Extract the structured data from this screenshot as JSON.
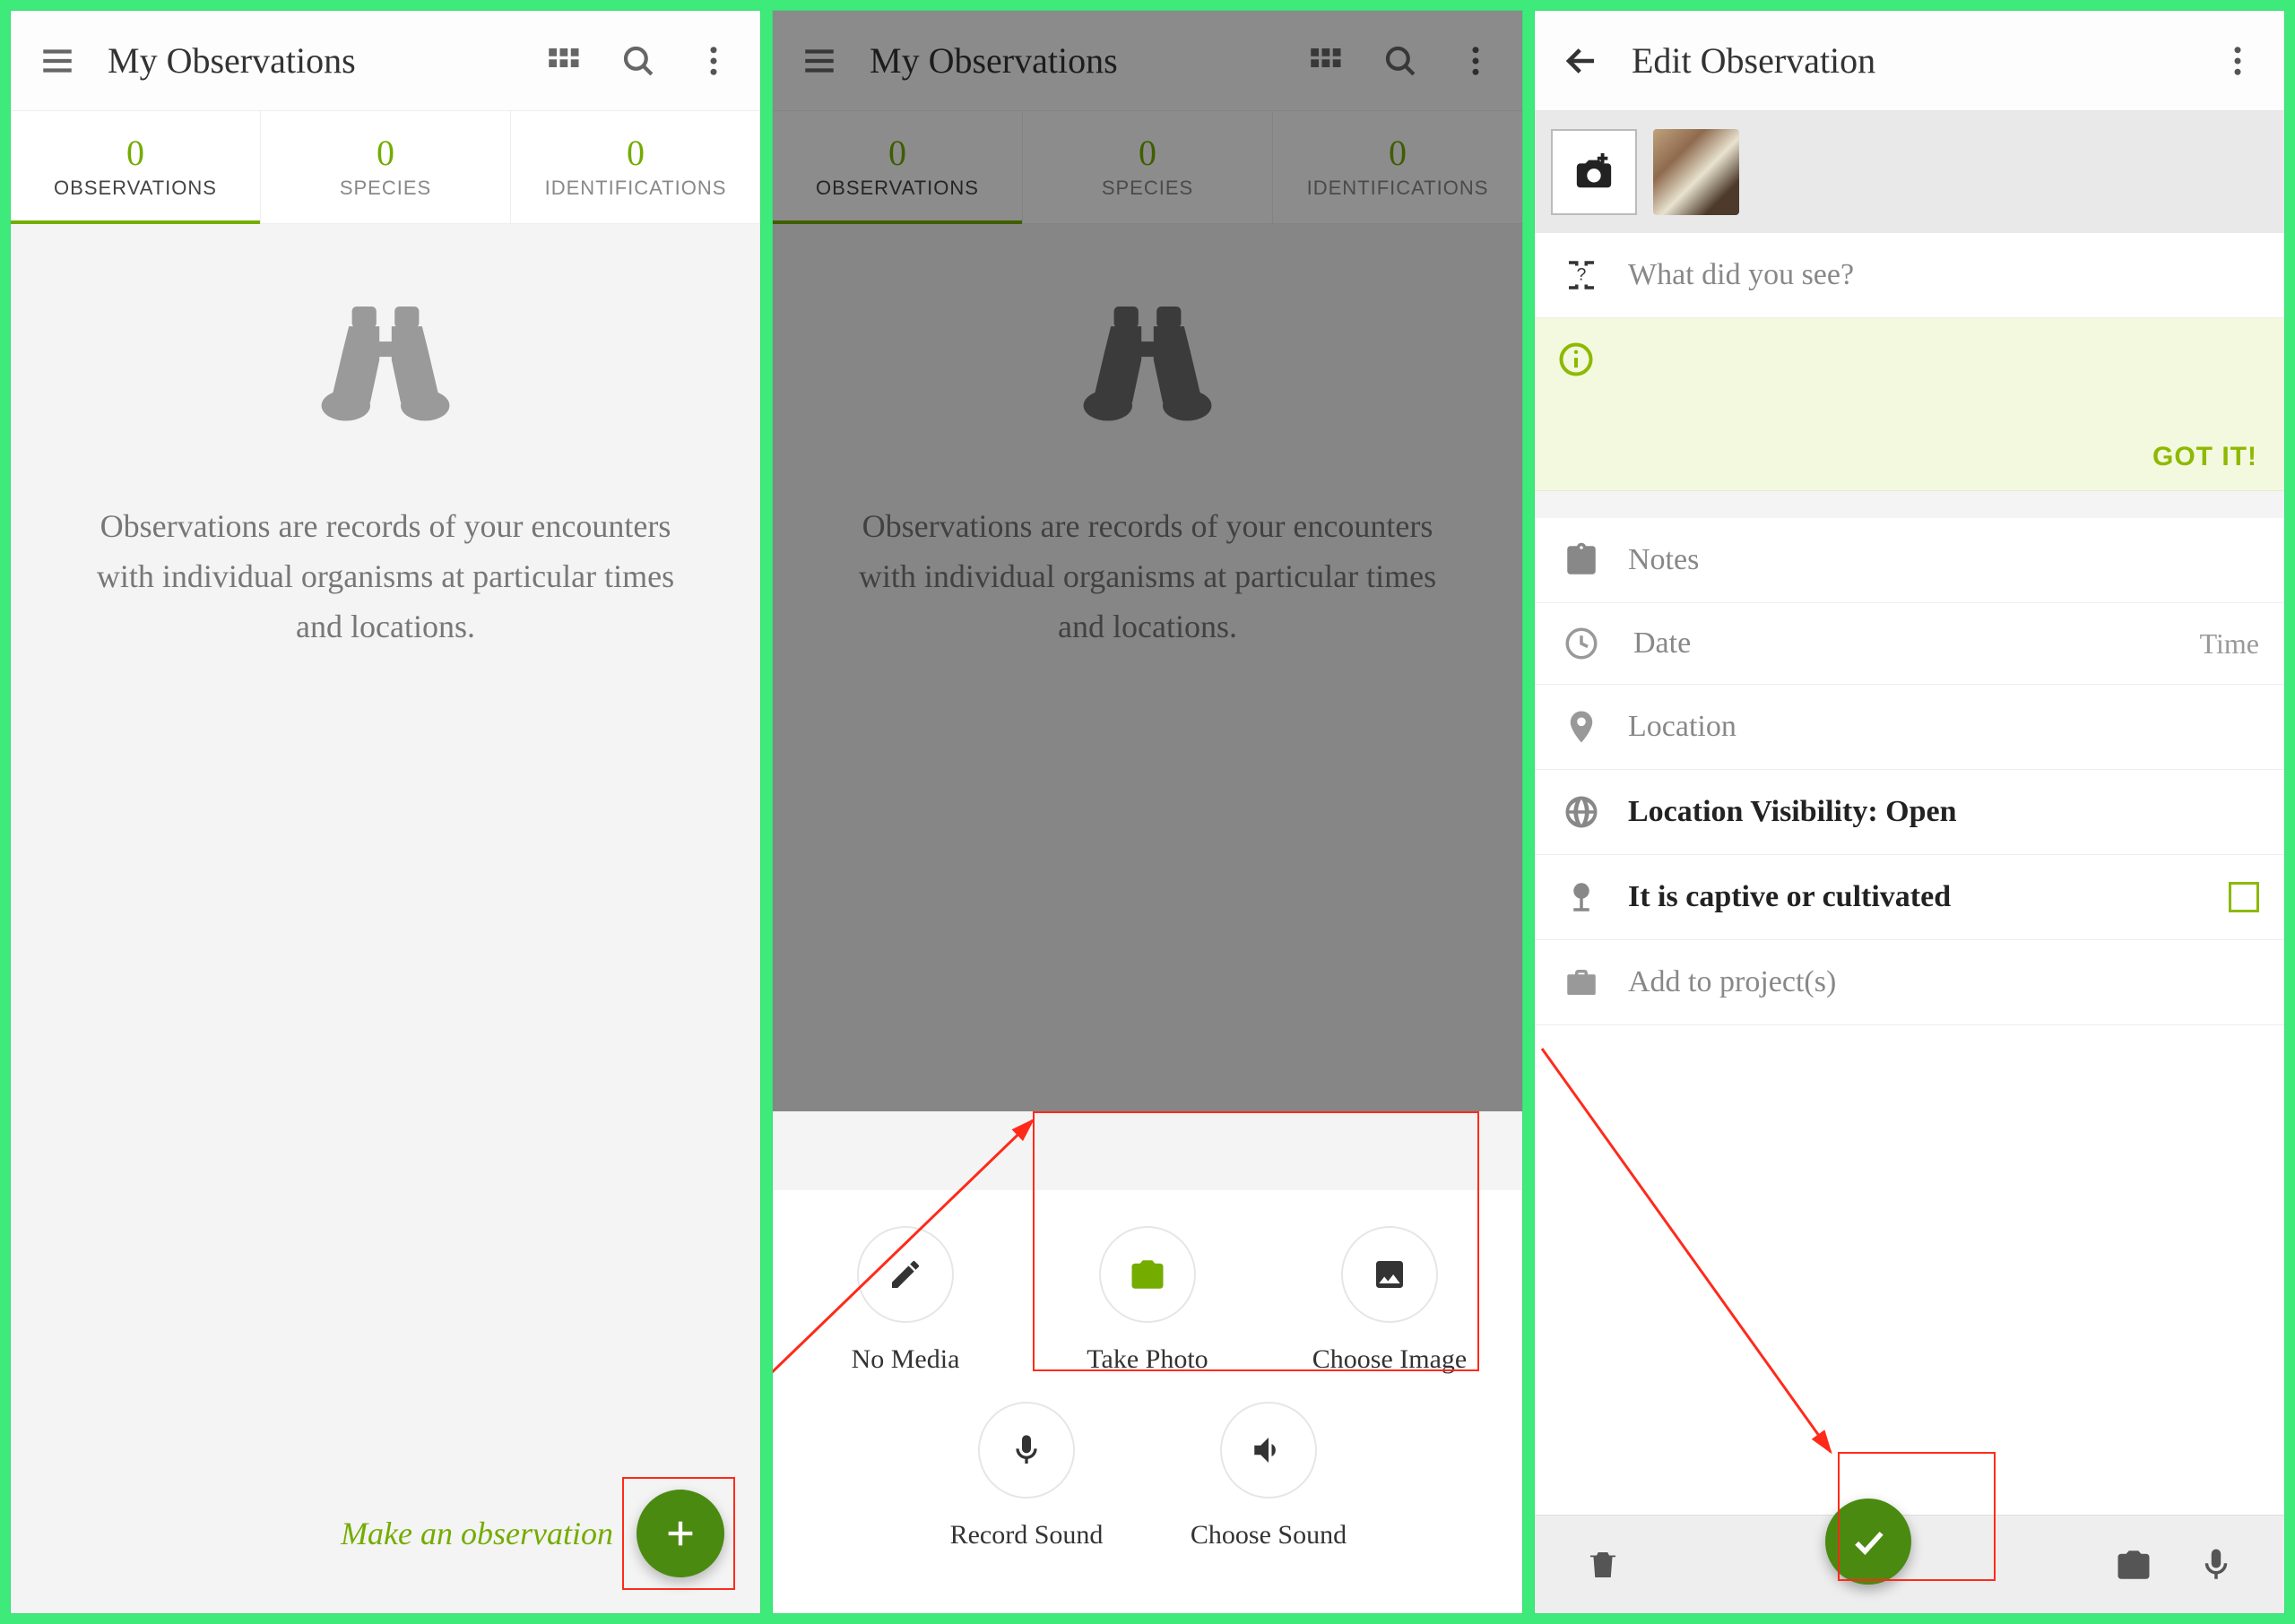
{
  "colors": {
    "accent": "#74ac00",
    "fab": "#4a8a10",
    "highlight": "#ff2a1a"
  },
  "screens": {
    "obs": {
      "title": "My Observations",
      "stats": [
        {
          "count": "0",
          "label": "OBSERVATIONS"
        },
        {
          "count": "0",
          "label": "SPECIES"
        },
        {
          "count": "0",
          "label": "IDENTIFICATIONS"
        }
      ],
      "empty_msg": "Observations are records of your encounters with individual organisms at particular times and locations.",
      "make_obs": "Make an observation"
    },
    "sheet": {
      "items": [
        {
          "label": "No Media"
        },
        {
          "label": "Take Photo"
        },
        {
          "label": "Choose Image"
        },
        {
          "label": "Record Sound"
        },
        {
          "label": "Choose Sound"
        }
      ]
    },
    "edit": {
      "title": "Edit Observation",
      "what": "What did you see?",
      "gotit": "GOT IT!",
      "notes": "Notes",
      "date": "Date",
      "time": "Time",
      "location": "Location",
      "visibility": "Location Visibility: Open",
      "captive": "It is captive or cultivated",
      "projects": "Add to project(s)"
    }
  }
}
